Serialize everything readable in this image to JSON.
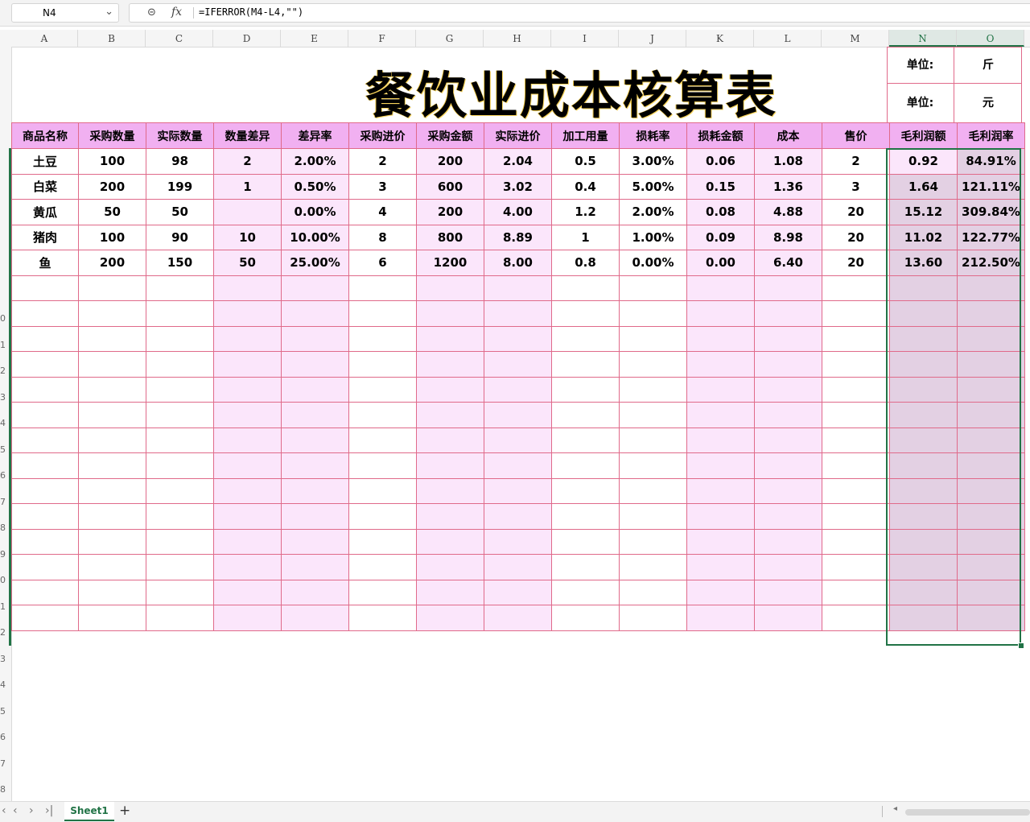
{
  "formula_bar": {
    "cell_ref": "N4",
    "formula": "=IFERROR(M4-L4,\"\")"
  },
  "columns": [
    "A",
    "B",
    "C",
    "D",
    "E",
    "F",
    "G",
    "H",
    "I",
    "J",
    "K",
    "L",
    "M",
    "N",
    "O"
  ],
  "row_numbers": [
    "0",
    "1",
    "2",
    "3",
    "4",
    "5",
    "6",
    "7",
    "8",
    "9",
    "0",
    "1",
    "2",
    "3",
    "4",
    "5",
    "6",
    "7",
    "8"
  ],
  "title": "餐饮业成本核算表",
  "units": {
    "weight_label": "单位:",
    "weight_value": "斤",
    "money_label": "单位:",
    "money_value": "元"
  },
  "table": {
    "headers": [
      "商品名称",
      "采购数量",
      "实际数量",
      "数量差异",
      "差异率",
      "采购进价",
      "采购金额",
      "实际进价",
      "加工用量",
      "损耗率",
      "损耗金额",
      "成本",
      "售价",
      "毛利润额",
      "毛利润率"
    ],
    "rows": [
      [
        "土豆",
        "100",
        "98",
        "2",
        "2.00%",
        "2",
        "200",
        "2.04",
        "0.5",
        "3.00%",
        "0.06",
        "1.08",
        "2",
        "0.92",
        "84.91%"
      ],
      [
        "白菜",
        "200",
        "199",
        "1",
        "0.50%",
        "3",
        "600",
        "3.02",
        "0.4",
        "5.00%",
        "0.15",
        "1.36",
        "3",
        "1.64",
        "121.11%"
      ],
      [
        "黄瓜",
        "50",
        "50",
        "",
        "0.00%",
        "4",
        "200",
        "4.00",
        "1.2",
        "2.00%",
        "0.08",
        "4.88",
        "20",
        "15.12",
        "309.84%"
      ],
      [
        "猪肉",
        "100",
        "90",
        "10",
        "10.00%",
        "8",
        "800",
        "8.89",
        "1",
        "1.00%",
        "0.09",
        "8.98",
        "20",
        "11.02",
        "122.77%"
      ],
      [
        "鱼",
        "200",
        "150",
        "50",
        "25.00%",
        "6",
        "1200",
        "8.00",
        "0.8",
        "0.00%",
        "0.00",
        "6.40",
        "20",
        "13.60",
        "212.50%"
      ]
    ],
    "empty_rows": 14
  },
  "sheet_tabs": {
    "active": "Sheet1",
    "add_label": "+"
  },
  "colors": {
    "header_fill": "#f1b0f1",
    "pink_fill": "#fbe6fb",
    "border": "#e06a8a",
    "selection": "#217346"
  }
}
